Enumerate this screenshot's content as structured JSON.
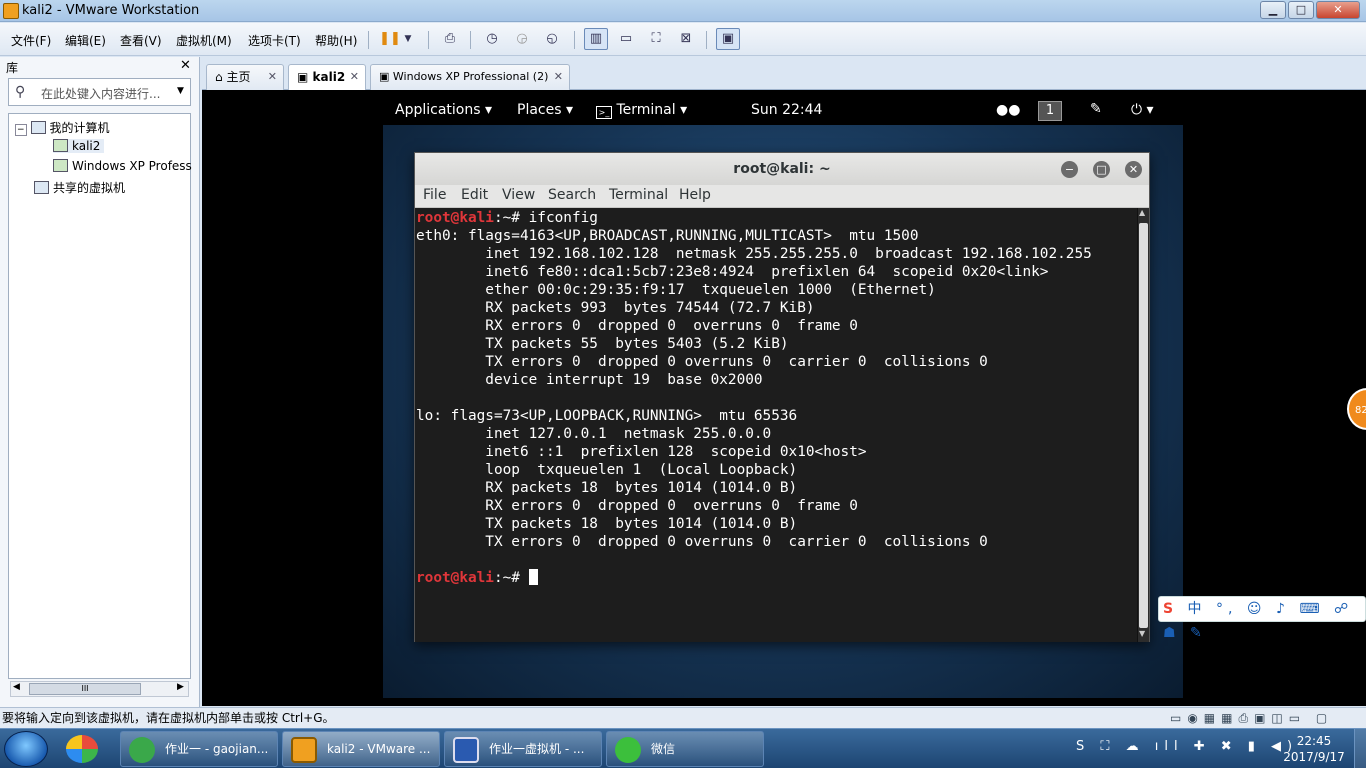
{
  "window": {
    "title": "kali2 - VMware Workstation",
    "min": "▁",
    "max": "□",
    "close": "✕"
  },
  "menubar": {
    "items": [
      "文件(F)",
      "编辑(E)",
      "查看(V)",
      "虚拟机(M)",
      "选项卡(T)",
      "帮助(H)"
    ]
  },
  "toolbar": {
    "icons": [
      "pause-icon",
      "dropdown-icon",
      "send-ctrl-alt-del-icon",
      "snapshot-icon",
      "revert-snapshot-icon",
      "snapshot-manager-icon",
      "show-library-icon",
      "thumbnail-icon",
      "fullscreen-icon",
      "unity-icon",
      "console-view-icon"
    ]
  },
  "library": {
    "title": "库",
    "close": "✕",
    "search_placeholder": "在此处键入内容进行...",
    "tree": {
      "root": "我的计算机",
      "children": [
        "kali2",
        "Windows XP Profess"
      ],
      "shared": "共享的虚拟机"
    },
    "scroll_label": "III"
  },
  "tabs": [
    {
      "label": "主页",
      "selected": false
    },
    {
      "label": "kali2",
      "selected": true
    },
    {
      "label": "Windows XP Professional (2)",
      "selected": false
    }
  ],
  "tab_close": "✕",
  "gnome": {
    "applications": "Applications ▾",
    "places": "Places ▾",
    "terminal": "Terminal ▾",
    "clock": "Sun 22:44",
    "workspace": "1",
    "power": "⏻ ▾"
  },
  "terminal": {
    "title": "root@kali: ~",
    "menu": [
      "File",
      "Edit",
      "View",
      "Search",
      "Terminal",
      "Help"
    ],
    "prompt": "root@kali",
    "prompt_suffix": ":~# ",
    "command": "ifconfig",
    "output": [
      "eth0: flags=4163<UP,BROADCAST,RUNNING,MULTICAST>  mtu 1500",
      "        inet 192.168.102.128  netmask 255.255.255.0  broadcast 192.168.102.255",
      "        inet6 fe80::dca1:5cb7:23e8:4924  prefixlen 64  scopeid 0x20<link>",
      "        ether 00:0c:29:35:f9:17  txqueuelen 1000  (Ethernet)",
      "        RX packets 993  bytes 74544 (72.7 KiB)",
      "        RX errors 0  dropped 0  overruns 0  frame 0",
      "        TX packets 55  bytes 5403 (5.2 KiB)",
      "        TX errors 0  dropped 0 overruns 0  carrier 0  collisions 0",
      "        device interrupt 19  base 0x2000",
      "",
      "lo: flags=73<UP,LOOPBACK,RUNNING>  mtu 65536",
      "        inet 127.0.0.1  netmask 255.0.0.0",
      "        inet6 ::1  prefixlen 128  scopeid 0x10<host>",
      "        loop  txqueuelen 1  (Local Loopback)",
      "        RX packets 18  bytes 1014 (1014.0 B)",
      "        RX errors 0  dropped 0  overruns 0  frame 0",
      "        TX packets 18  bytes 1014 (1014.0 B)",
      "        TX errors 0  dropped 0 overruns 0  carrier 0  collisions 0",
      ""
    ]
  },
  "statusbar": {
    "text": "要将输入定向到该虚拟机，请在虚拟机内部单击或按 Ctrl+G。"
  },
  "ime": {
    "logo": "S",
    "text": "中 °, ☺ ♪ ⌨ ☍ ☗ ✎"
  },
  "badge": "82",
  "taskbar": {
    "items": [
      {
        "label": "作业一 - gaojian...",
        "icon": "ie-icon"
      },
      {
        "label": "kali2 - VMware ...",
        "icon": "vmware-icon"
      },
      {
        "label": "作业一虚拟机 - ...",
        "icon": "word-icon"
      },
      {
        "label": "微信",
        "icon": "wechat-icon"
      }
    ],
    "tray": "S ⛶ ☁ ıll ✚ ✖ ▮ ◀)",
    "time": "22:45",
    "date": "2017/9/17"
  }
}
